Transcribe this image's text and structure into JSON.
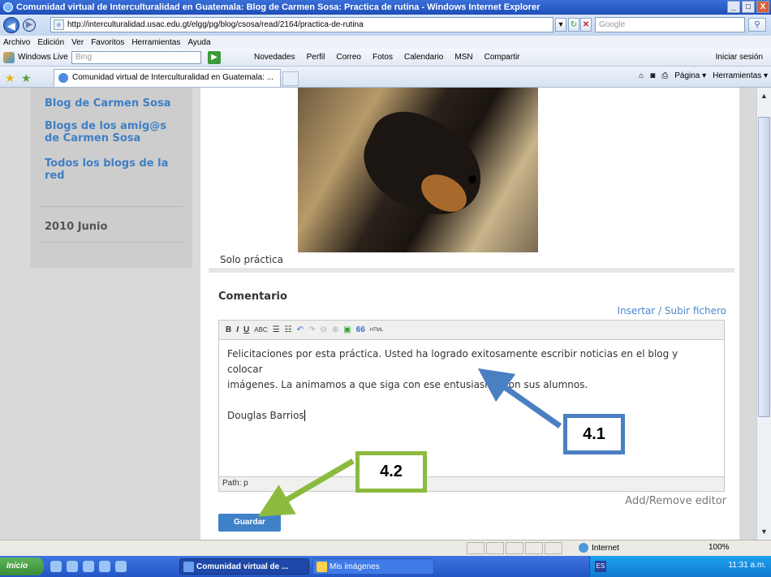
{
  "window": {
    "title": "Comunidad virtual de Interculturalidad en Guatemala: Blog de Carmen Sosa: Practica de rutina - Windows Internet Explorer",
    "buttons": [
      "_",
      "□",
      "X"
    ]
  },
  "address_bar": {
    "url": "http://interculturalidad.usac.edu.gt/elgg/pg/blog/csosa/read/2164/practica-de-rutina",
    "search_placeholder": "Google"
  },
  "menu": [
    "Archivo",
    "Edición",
    "Ver",
    "Favoritos",
    "Herramientas",
    "Ayuda"
  ],
  "live_bar": {
    "label": "Windows Live",
    "search_placeholder": "Bing",
    "links": [
      "Novedades",
      "Perfil",
      "Correo",
      "Fotos",
      "Calendario",
      "MSN",
      "Compartir"
    ],
    "signin": "Iniciar sesión"
  },
  "tab": {
    "label": "Comunidad virtual de Interculturalidad en Guatemala: ...",
    "commands": [
      "Página ▾",
      "Herramientas ▾"
    ]
  },
  "sidebar": {
    "links": [
      "Blog de Carmen Sosa",
      "Blogs de los amig@s de Carmen Sosa",
      "Todos los blogs de la red"
    ],
    "archive": "2010 Junio"
  },
  "post": {
    "caption": "Solo práctica"
  },
  "comment": {
    "heading": "Comentario",
    "upload_link": "Insertar / Subir fichero",
    "toolbar": [
      "B",
      "I",
      "U",
      "ABC",
      "☰",
      "☷",
      "↶",
      "↷",
      "⊖",
      "⊕",
      "▣",
      "66",
      "HTML"
    ],
    "text_lines": [
      "Felicitaciones por esta práctica. Usted ha logrado exitosamente escribir noticias en el blog y colocar",
      "imágenes. La animamos a que siga con ese entusiasmo con sus alumnos."
    ],
    "signature": "Douglas Barrios",
    "path_label": "Path: p",
    "add_remove": "Add/Remove editor",
    "save_label": "Guardar"
  },
  "status_bar": {
    "zone": "Internet",
    "zoom": "100%"
  },
  "taskbar": {
    "start": "Inicio",
    "tasks": [
      "Comunidad virtual de ...",
      "Mis imágenes"
    ],
    "lang": "ES",
    "clock": "11:31 a.m."
  },
  "annotations": {
    "callout_1": "4.1",
    "callout_2": "4.2",
    "arrow_1_color": "#4a7fc1",
    "arrow_2_color": "#8bba3f"
  }
}
